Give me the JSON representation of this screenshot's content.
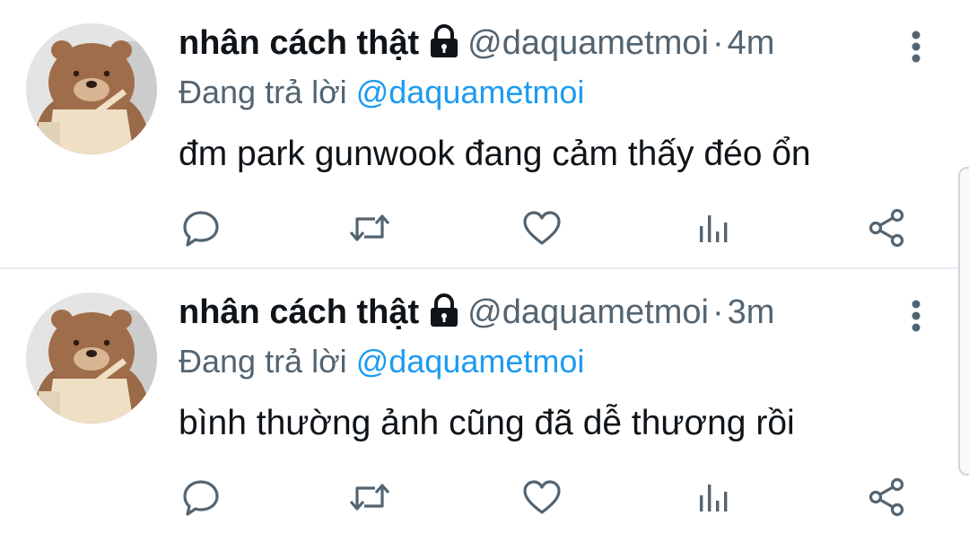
{
  "tweets": [
    {
      "display_name": "nhân cách thật",
      "handle": "@daquametmoi",
      "separator": "·",
      "time": "4m",
      "reply_prefix": "Đang trả lời",
      "reply_to": "@daquametmoi",
      "text": "đm park gunwook đang cảm thấy đéo ổn",
      "protected_icon": "lock-icon",
      "actions": [
        "reply-icon",
        "retweet-icon",
        "like-icon",
        "analytics-icon",
        "share-icon"
      ]
    },
    {
      "display_name": "nhân cách thật",
      "handle": "@daquametmoi",
      "separator": "·",
      "time": "3m",
      "reply_prefix": "Đang trả lời",
      "reply_to": "@daquametmoi",
      "text": "bình thường ảnh cũng đã dễ thương rồi",
      "protected_icon": "lock-icon",
      "actions": [
        "reply-icon",
        "retweet-icon",
        "like-icon",
        "analytics-icon",
        "share-icon"
      ]
    }
  ],
  "colors": {
    "text_primary": "#0f1419",
    "text_secondary": "#536471",
    "link": "#1d9bf0",
    "icon": "#536471",
    "divider": "#e6ecf0"
  }
}
